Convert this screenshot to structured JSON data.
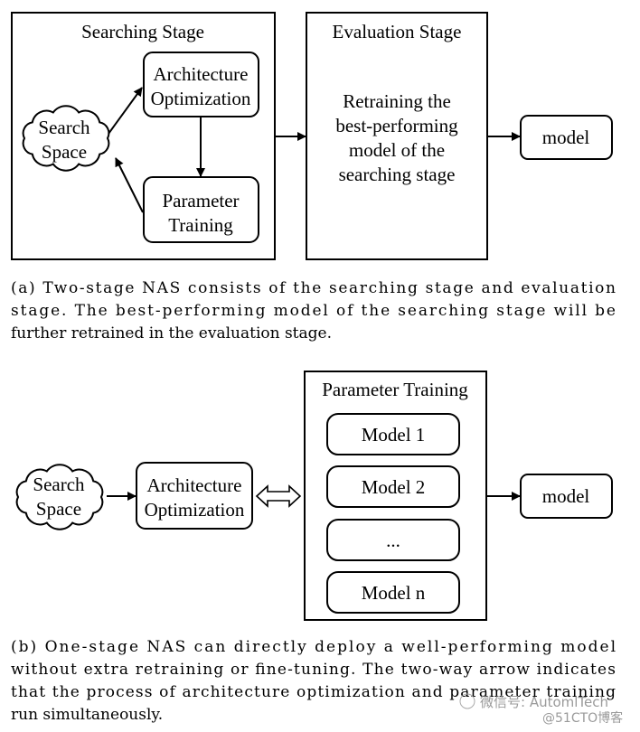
{
  "diagram_a": {
    "searching_stage": {
      "title": "Searching Stage",
      "search_space": [
        "Search",
        "Space"
      ],
      "architecture_optimization": [
        "Architecture",
        "Optimization"
      ],
      "parameter_training": [
        "Parameter",
        "Training"
      ]
    },
    "evaluation_stage": {
      "title": "Evaluation Stage",
      "text": [
        "Retraining the",
        "best-performing",
        "model of the",
        "searching stage"
      ]
    },
    "output": "model",
    "caption": [
      "(a)  Two-stage NAS consists of the searching stage and evaluation",
      "stage.  The best-performing model of the searching stage will be",
      "further retrained in the evaluation stage."
    ]
  },
  "diagram_b": {
    "search_space": [
      "Search",
      "Space"
    ],
    "architecture_optimization": [
      "Architecture",
      "Optimization"
    ],
    "parameter_training": {
      "title": "Parameter Training",
      "models": [
        "Model 1",
        "Model 2",
        "...",
        "Model n"
      ]
    },
    "output": "model",
    "caption": [
      "(b)  One-stage NAS can directly deploy a well-performing model",
      "without extra retraining or fine-tuning.  The two-way arrow indicates",
      "that the process of architecture optimization and parameter training",
      "run simultaneously."
    ]
  },
  "watermark": {
    "line1": "微信号: AutomlTech",
    "line2": "@51CTO博客"
  }
}
